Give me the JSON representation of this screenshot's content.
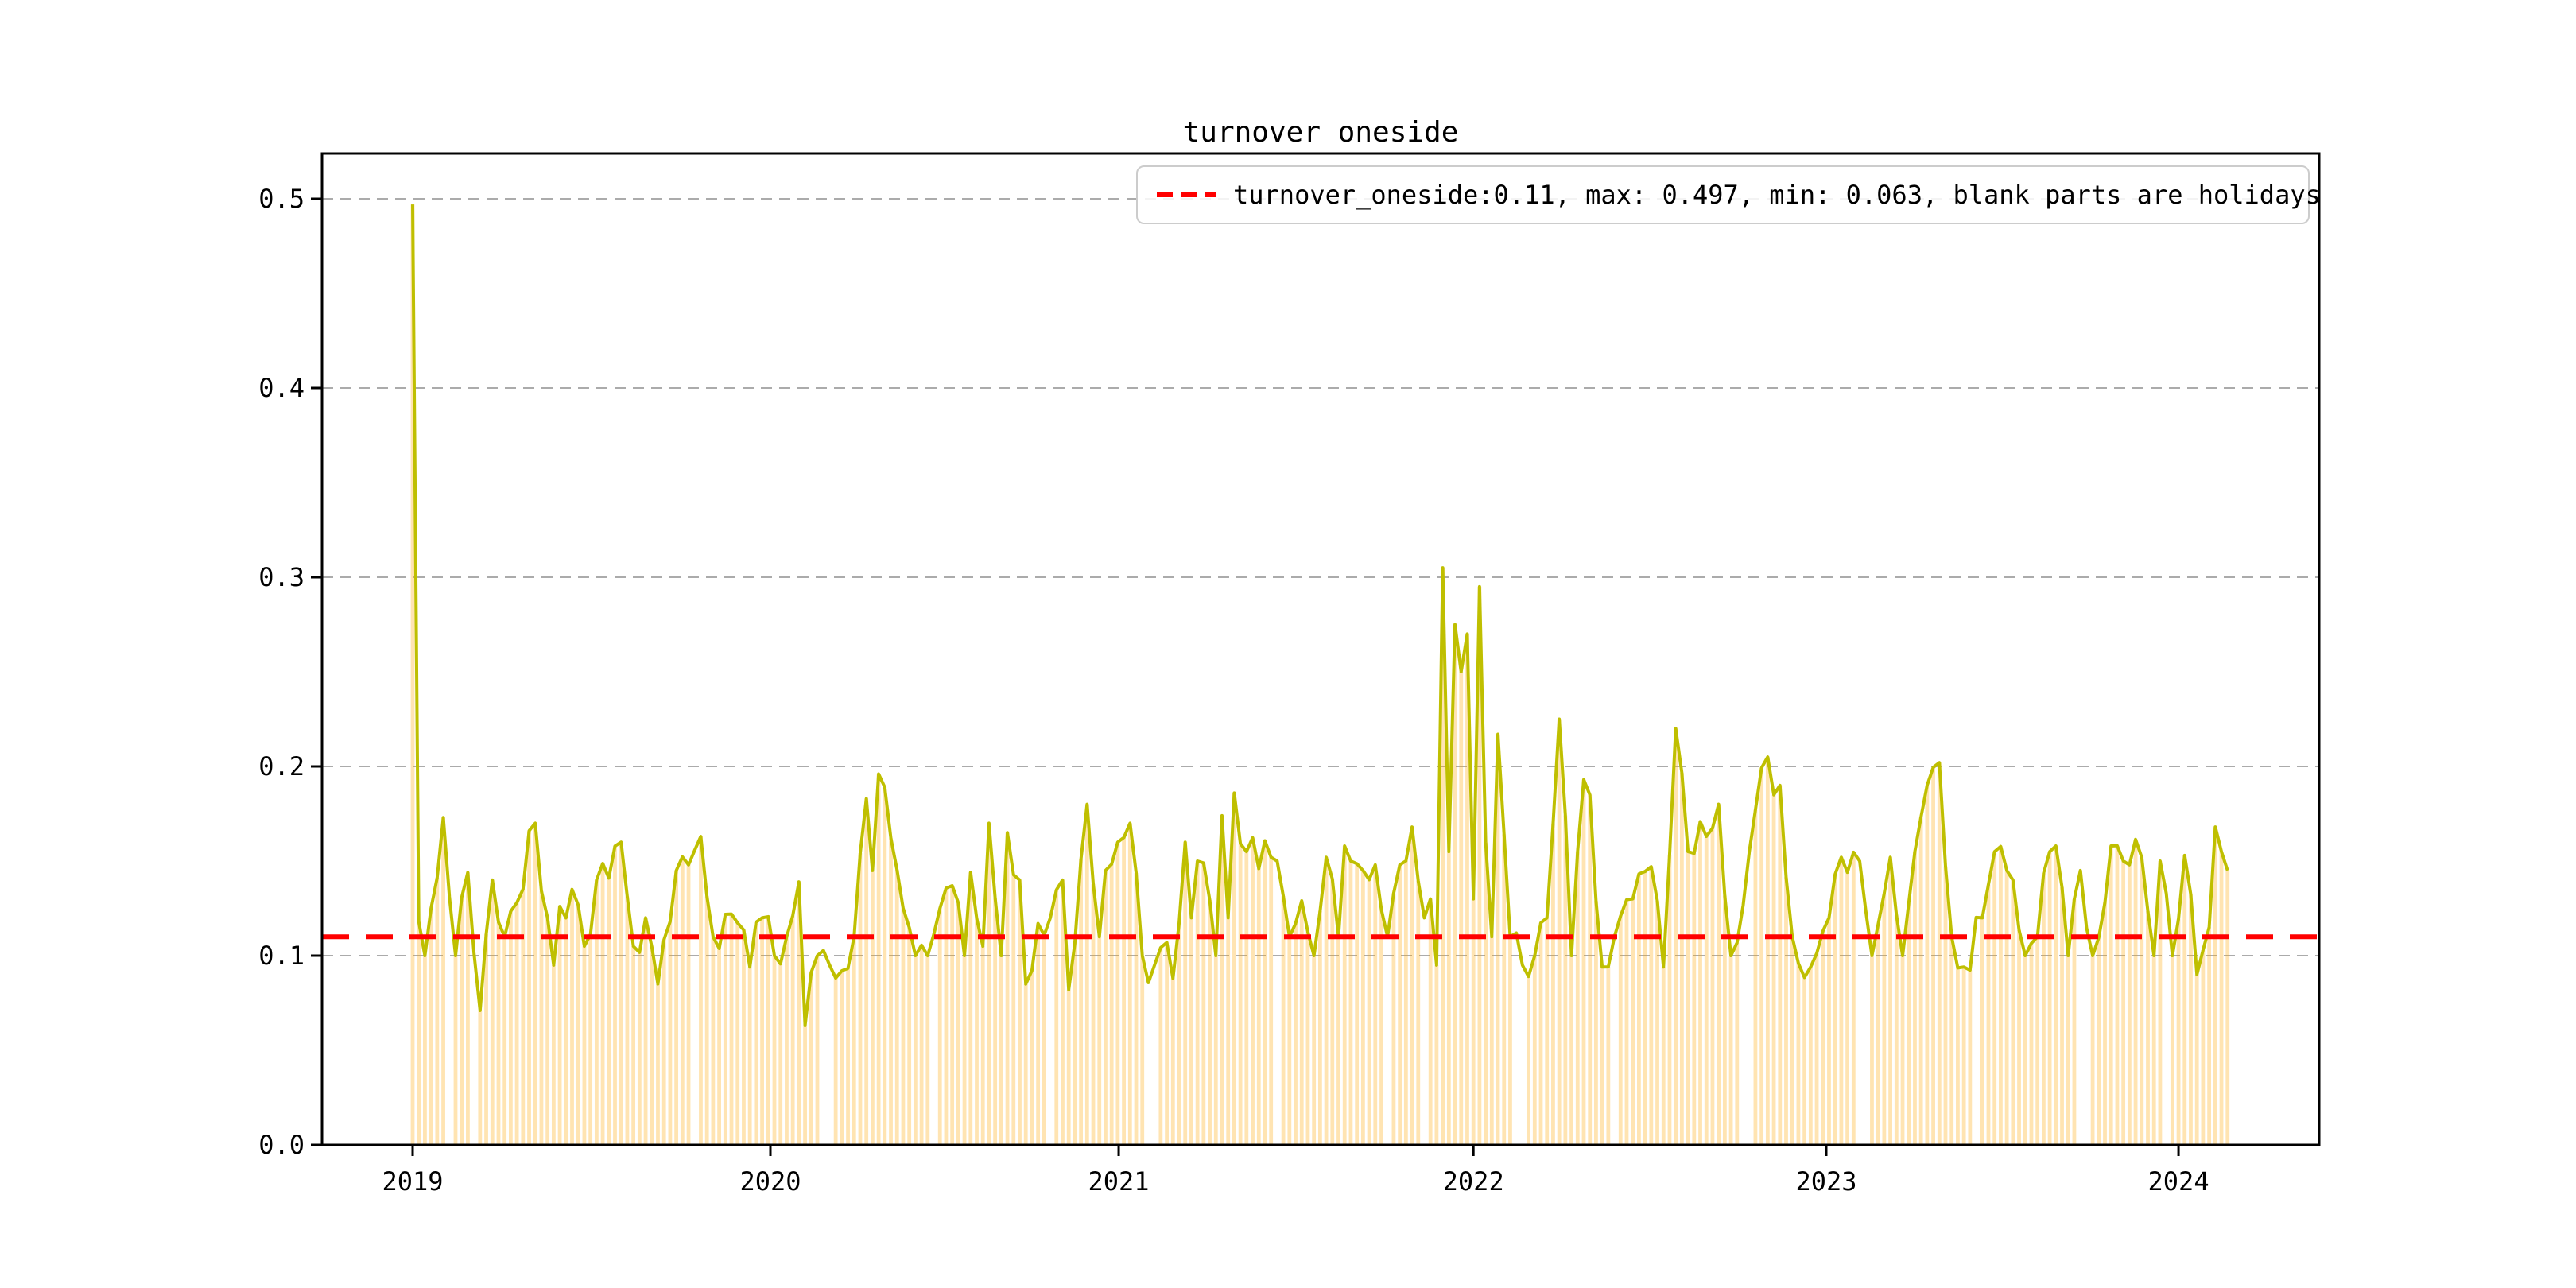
{
  "chart_data": {
    "type": "line",
    "title": "turnover oneside",
    "series_name": "turnover_oneside",
    "legend": {
      "label": "turnover_oneside:0.11, max: 0.497, min: 0.063, blank parts are holidays",
      "position": "upper right",
      "marker": "red-dashed-line"
    },
    "stats": {
      "turnover_oneside": 0.11,
      "max": 0.497,
      "min": 0.063
    },
    "threshold": 0.11,
    "grid": true,
    "ylim": [
      0.0,
      0.524
    ],
    "yticks": [
      {
        "label": "0.0",
        "value": 0.0
      },
      {
        "label": "0.1",
        "value": 0.1
      },
      {
        "label": "0.2",
        "value": 0.2
      },
      {
        "label": "0.3",
        "value": 0.3
      },
      {
        "label": "0.4",
        "value": 0.4
      },
      {
        "label": "0.5",
        "value": 0.5
      }
    ],
    "xticks": [
      {
        "label": "2019",
        "index": 0
      },
      {
        "label": "2020",
        "index": 58.35
      },
      {
        "label": "2021",
        "index": 115.15
      },
      {
        "label": "2022",
        "index": 173.0
      },
      {
        "label": "2023",
        "index": 230.55
      },
      {
        "label": "2024",
        "index": 288.0
      }
    ],
    "x_axis_note": "trading dates 2019-01 to 2024-02, blank parts are holidays",
    "n_points": 297,
    "noise_amplitude": 0.012,
    "seed": 42,
    "anchors": [
      [
        0,
        0.497
      ],
      [
        1,
        0.118
      ],
      [
        2,
        0.1
      ],
      [
        3,
        0.125
      ],
      [
        5,
        0.173
      ],
      [
        7,
        0.1
      ],
      [
        9,
        0.144
      ],
      [
        11,
        0.071
      ],
      [
        13,
        0.14
      ],
      [
        15,
        0.11
      ],
      [
        17,
        0.128
      ],
      [
        19,
        0.166
      ],
      [
        20,
        0.17
      ],
      [
        22,
        0.12
      ],
      [
        23,
        0.095
      ],
      [
        24,
        0.126
      ],
      [
        26,
        0.135
      ],
      [
        28,
        0.105
      ],
      [
        30,
        0.14
      ],
      [
        32,
        0.141
      ],
      [
        34,
        0.16
      ],
      [
        36,
        0.105
      ],
      [
        38,
        0.12
      ],
      [
        40,
        0.085
      ],
      [
        43,
        0.145
      ],
      [
        45,
        0.148
      ],
      [
        47,
        0.163
      ],
      [
        49,
        0.11
      ],
      [
        52,
        0.122
      ],
      [
        55,
        0.094
      ],
      [
        57,
        0.12
      ],
      [
        59,
        0.1
      ],
      [
        61,
        0.11
      ],
      [
        63,
        0.139
      ],
      [
        64,
        0.063
      ],
      [
        66,
        0.1
      ],
      [
        68,
        0.095
      ],
      [
        70,
        0.092
      ],
      [
        72,
        0.11
      ],
      [
        74,
        0.183
      ],
      [
        75,
        0.145
      ],
      [
        76,
        0.196
      ],
      [
        78,
        0.162
      ],
      [
        80,
        0.125
      ],
      [
        82,
        0.1
      ],
      [
        84,
        0.1
      ],
      [
        86,
        0.125
      ],
      [
        88,
        0.137
      ],
      [
        90,
        0.1
      ],
      [
        91,
        0.144
      ],
      [
        93,
        0.105
      ],
      [
        94,
        0.17
      ],
      [
        96,
        0.1
      ],
      [
        97,
        0.165
      ],
      [
        99,
        0.14
      ],
      [
        100,
        0.085
      ],
      [
        102,
        0.117
      ],
      [
        104,
        0.12
      ],
      [
        106,
        0.14
      ],
      [
        107,
        0.082
      ],
      [
        110,
        0.18
      ],
      [
        112,
        0.11
      ],
      [
        113,
        0.145
      ],
      [
        115,
        0.16
      ],
      [
        117,
        0.17
      ],
      [
        119,
        0.1
      ],
      [
        121,
        0.095
      ],
      [
        123,
        0.107
      ],
      [
        124,
        0.088
      ],
      [
        126,
        0.16
      ],
      [
        127,
        0.12
      ],
      [
        128,
        0.15
      ],
      [
        129,
        0.149
      ],
      [
        131,
        0.1
      ],
      [
        132,
        0.174
      ],
      [
        133,
        0.12
      ],
      [
        134,
        0.186
      ],
      [
        136,
        0.155
      ],
      [
        138,
        0.146
      ],
      [
        140,
        0.152
      ],
      [
        141,
        0.15
      ],
      [
        143,
        0.11
      ],
      [
        145,
        0.129
      ],
      [
        147,
        0.1
      ],
      [
        149,
        0.152
      ],
      [
        151,
        0.11
      ],
      [
        152,
        0.158
      ],
      [
        153,
        0.15
      ],
      [
        155,
        0.145
      ],
      [
        157,
        0.148
      ],
      [
        159,
        0.11
      ],
      [
        161,
        0.148
      ],
      [
        163,
        0.168
      ],
      [
        165,
        0.12
      ],
      [
        166,
        0.13
      ],
      [
        167,
        0.095
      ],
      [
        168,
        0.305
      ],
      [
        169,
        0.155
      ],
      [
        170,
        0.275
      ],
      [
        171,
        0.25
      ],
      [
        172,
        0.27
      ],
      [
        173,
        0.13
      ],
      [
        174,
        0.295
      ],
      [
        175,
        0.16
      ],
      [
        176,
        0.11
      ],
      [
        177,
        0.217
      ],
      [
        179,
        0.11
      ],
      [
        181,
        0.095
      ],
      [
        183,
        0.1
      ],
      [
        185,
        0.12
      ],
      [
        187,
        0.225
      ],
      [
        189,
        0.1
      ],
      [
        191,
        0.193
      ],
      [
        192,
        0.185
      ],
      [
        194,
        0.094
      ],
      [
        196,
        0.11
      ],
      [
        199,
        0.13
      ],
      [
        202,
        0.147
      ],
      [
        204,
        0.094
      ],
      [
        206,
        0.22
      ],
      [
        208,
        0.155
      ],
      [
        211,
        0.163
      ],
      [
        213,
        0.18
      ],
      [
        215,
        0.1
      ],
      [
        218,
        0.155
      ],
      [
        221,
        0.205
      ],
      [
        222,
        0.185
      ],
      [
        223,
        0.19
      ],
      [
        225,
        0.11
      ],
      [
        228,
        0.094
      ],
      [
        231,
        0.12
      ],
      [
        233,
        0.152
      ],
      [
        236,
        0.15
      ],
      [
        238,
        0.1
      ],
      [
        241,
        0.152
      ],
      [
        243,
        0.1
      ],
      [
        245,
        0.155
      ],
      [
        247,
        0.19
      ],
      [
        249,
        0.202
      ],
      [
        251,
        0.11
      ],
      [
        253,
        0.094
      ],
      [
        256,
        0.12
      ],
      [
        258,
        0.155
      ],
      [
        260,
        0.145
      ],
      [
        261,
        0.14
      ],
      [
        263,
        0.1
      ],
      [
        265,
        0.11
      ],
      [
        267,
        0.155
      ],
      [
        268,
        0.158
      ],
      [
        270,
        0.1
      ],
      [
        272,
        0.145
      ],
      [
        274,
        0.1
      ],
      [
        277,
        0.158
      ],
      [
        279,
        0.15
      ],
      [
        280,
        0.148
      ],
      [
        282,
        0.152
      ],
      [
        284,
        0.1
      ],
      [
        285,
        0.15
      ],
      [
        287,
        0.1
      ],
      [
        289,
        0.153
      ],
      [
        291,
        0.09
      ],
      [
        293,
        0.115
      ],
      [
        294,
        0.168
      ],
      [
        295,
        0.155
      ],
      [
        296,
        0.145
      ]
    ],
    "holiday_gap_indices": [
      6,
      10,
      46,
      67,
      68,
      85,
      104,
      120,
      121,
      141,
      159,
      165,
      180,
      181,
      196,
      217,
      218,
      236,
      237,
      255,
      272,
      273,
      286
    ],
    "colors": {
      "line": "#bfbf00",
      "bar": "rgba(255,165,0,0.30)",
      "threshold": "#ff0000",
      "grid": "#ababab",
      "axis": "#000000",
      "text": "#000000",
      "legend_border": "#cccccc"
    }
  }
}
